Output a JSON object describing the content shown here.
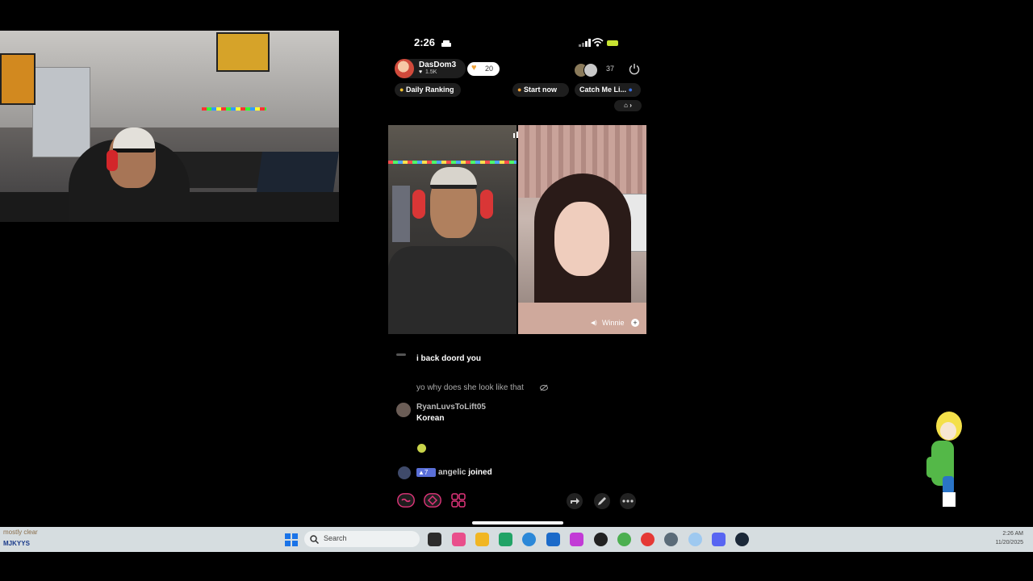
{
  "phone": {
    "status_time": "2:26",
    "host": {
      "name": "DasDom3",
      "likes": "1.5K",
      "gift_count": "20"
    },
    "viewer_count": "37",
    "pills": {
      "daily_ranking": "Daily Ranking",
      "start_now": "Start now",
      "catch_me": "Catch Me Li..."
    },
    "guest_name": "Winnie",
    "chat": [
      {
        "user": "",
        "text": "i back doord you"
      },
      {
        "user": "",
        "text": "yo why does she look like that"
      },
      {
        "user": "RyanLuvsToLift05",
        "text": "Korean"
      },
      {
        "user": "",
        "text": ""
      }
    ],
    "join_event": {
      "level": "7",
      "user": "angelic",
      "action": "joined"
    }
  },
  "taskbar": {
    "ticker": "MJKYYS",
    "ticker_sub": "mostly clear",
    "search_placeholder": "Search",
    "time": "2:26 AM",
    "date": "11/20/2025"
  },
  "colors": {
    "accent_pink": "#e0347a",
    "battery": "#c8e332",
    "taskbar_bg": "#d6dde0"
  }
}
